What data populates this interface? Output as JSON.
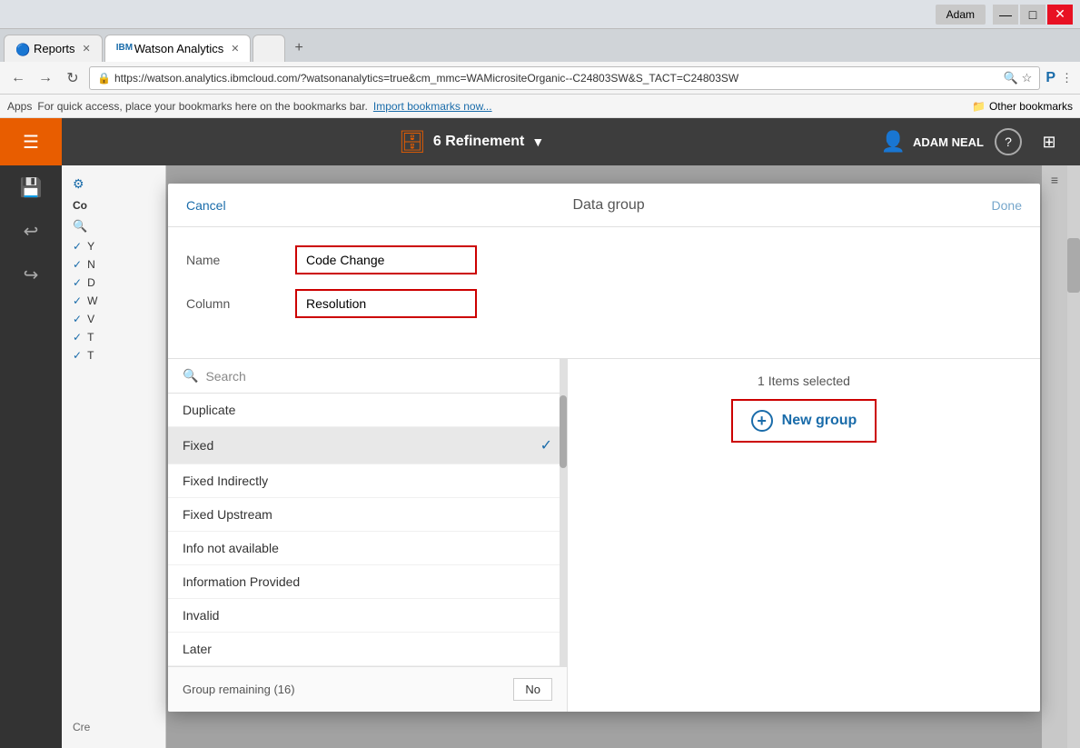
{
  "browser": {
    "user": "Adam",
    "tabs": [
      {
        "label": "Reports",
        "active": false,
        "icon": "🔵"
      },
      {
        "label": "Watson Analytics",
        "active": true,
        "icon": "IBM"
      },
      {
        "label": "",
        "active": false,
        "icon": ""
      }
    ],
    "address": "https://watson.analytics.ibmcloud.com/?watsonanalytics=true&cm_mmc=WAMicrositeOrganic--C24803SW&S_TACT=C24803SW",
    "bookmarks_text": "For quick access, place your bookmarks here on the bookmarks bar.",
    "bookmarks_link": "Import bookmarks now...",
    "bookmarks_right": "Other bookmarks",
    "apps_label": "Apps"
  },
  "toolbar": {
    "title": "6 Refinement",
    "user_name": "ADAM NEAL"
  },
  "sidebar": {
    "items": [
      "☰",
      "💾",
      "↩",
      "↪",
      "⚙"
    ]
  },
  "left_panel": {
    "title": "Co",
    "items": [
      {
        "label": "Y"
      },
      {
        "label": "N"
      },
      {
        "label": "D"
      },
      {
        "label": "W"
      },
      {
        "label": "V"
      },
      {
        "label": "T"
      },
      {
        "label": "T"
      }
    ]
  },
  "dialog": {
    "cancel_label": "Cancel",
    "title": "Data group",
    "done_label": "Done",
    "name_label": "Name",
    "name_value": "Code Change",
    "column_label": "Column",
    "column_value": "Resolution",
    "search_label": "Search",
    "list_items": [
      {
        "label": "Duplicate",
        "selected": false
      },
      {
        "label": "Fixed",
        "selected": true
      },
      {
        "label": "Fixed Indirectly",
        "selected": false
      },
      {
        "label": "Fixed Upstream",
        "selected": false
      },
      {
        "label": "Info not available",
        "selected": false
      },
      {
        "label": "Information Provided",
        "selected": false
      },
      {
        "label": "Invalid",
        "selected": false
      },
      {
        "label": "Later",
        "selected": false
      }
    ],
    "items_selected_count": "1 Items selected",
    "new_group_label": "New group",
    "group_remaining_label": "Group remaining (16)",
    "group_remaining_no": "No"
  }
}
